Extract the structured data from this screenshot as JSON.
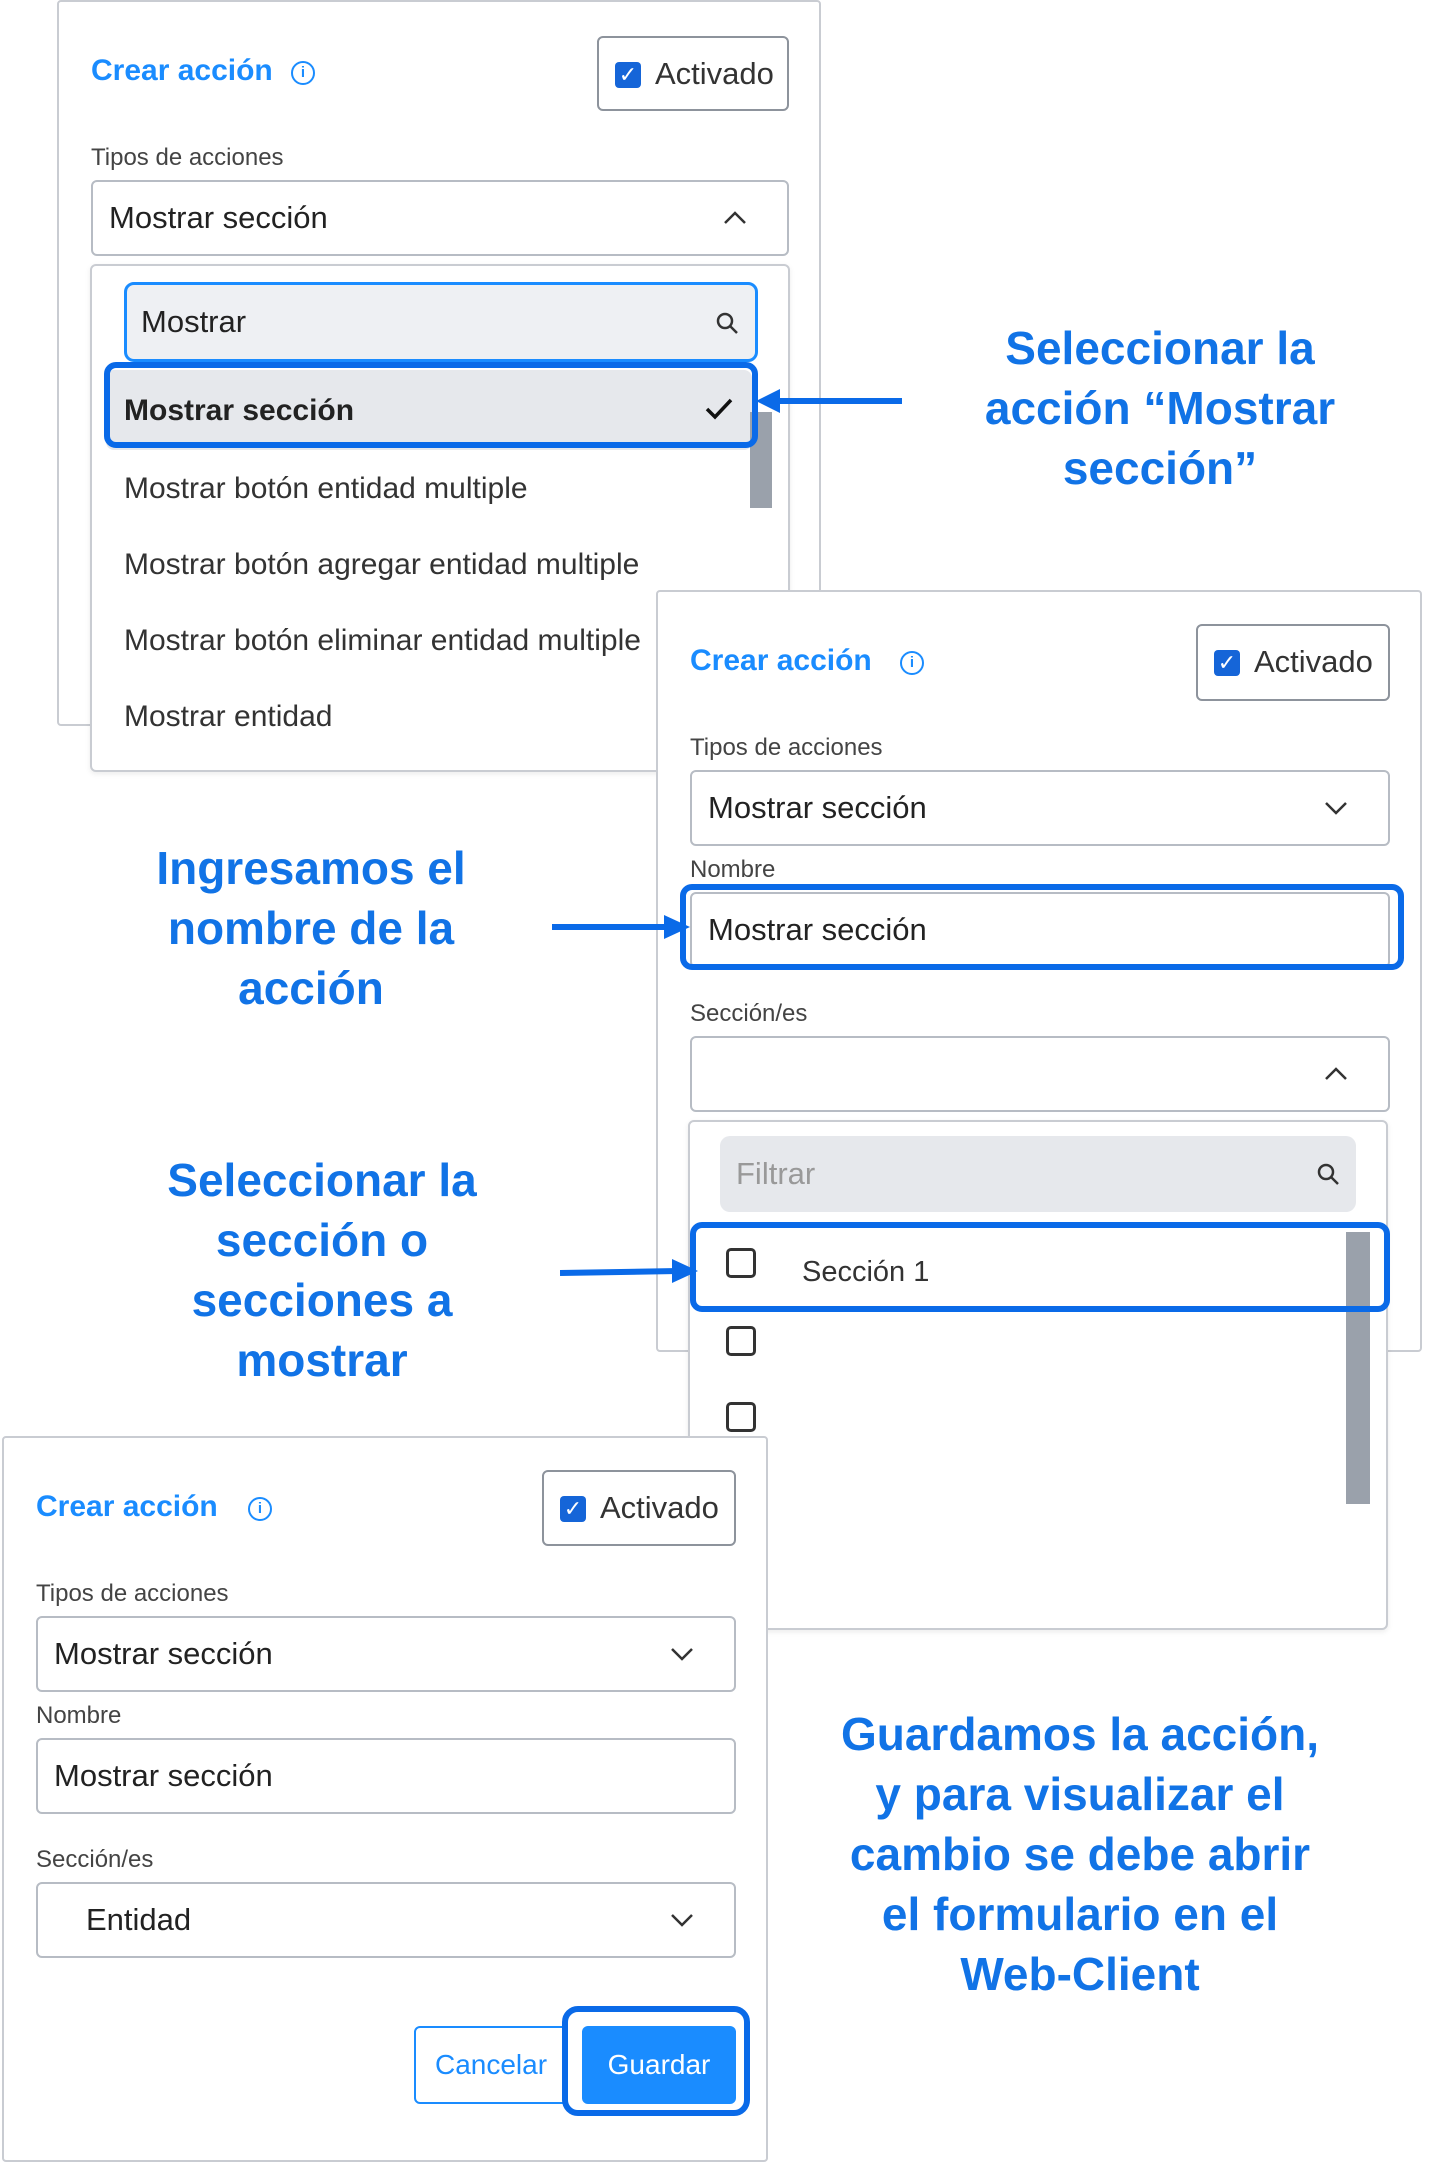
{
  "panel1": {
    "title": "Crear acción",
    "activado": "Activado",
    "types_label": "Tipos de acciones",
    "types_value": "Mostrar sección",
    "search_value": "Mostrar",
    "options": [
      "Mostrar sección",
      "Mostrar botón entidad multiple",
      "Mostrar botón agregar entidad multiple",
      "Mostrar botón eliminar entidad multiple",
      "Mostrar entidad"
    ]
  },
  "panel2": {
    "title": "Crear acción",
    "activado": "Activado",
    "types_label": "Tipos de acciones",
    "types_value": "Mostrar sección",
    "name_label": "Nombre",
    "name_value": "Mostrar sección",
    "sections_label": "Sección/es",
    "filter_placeholder": "Filtrar",
    "section_items": [
      "Sección 1",
      "",
      ""
    ]
  },
  "panel3": {
    "title": "Crear acción",
    "activado": "Activado",
    "types_label": "Tipos de acciones",
    "types_value": "Mostrar sección",
    "name_label": "Nombre",
    "name_value": "Mostrar sección",
    "sections_label": "Sección/es",
    "sections_value": "Entidad",
    "cancel": "Cancelar",
    "save": "Guardar"
  },
  "callouts": {
    "select_action": "Seleccionar la acción “Mostrar sección”",
    "enter_name": "Ingresamos el nombre de la acción",
    "select_section": "Seleccionar la sección o secciones a mostrar",
    "save_note": "Guardamos la acción, y para visualizar el cambio se debe abrir el formulario en el Web-Client"
  },
  "colors": {
    "accent": "#1a8cff",
    "callout": "#1173e6",
    "highlight": "#0a6ae8",
    "checkbox": "#1565d8"
  },
  "icons": [
    "info-icon",
    "search-icon",
    "check-icon",
    "chevron-up-icon",
    "chevron-down-icon",
    "arrow-icon"
  ]
}
